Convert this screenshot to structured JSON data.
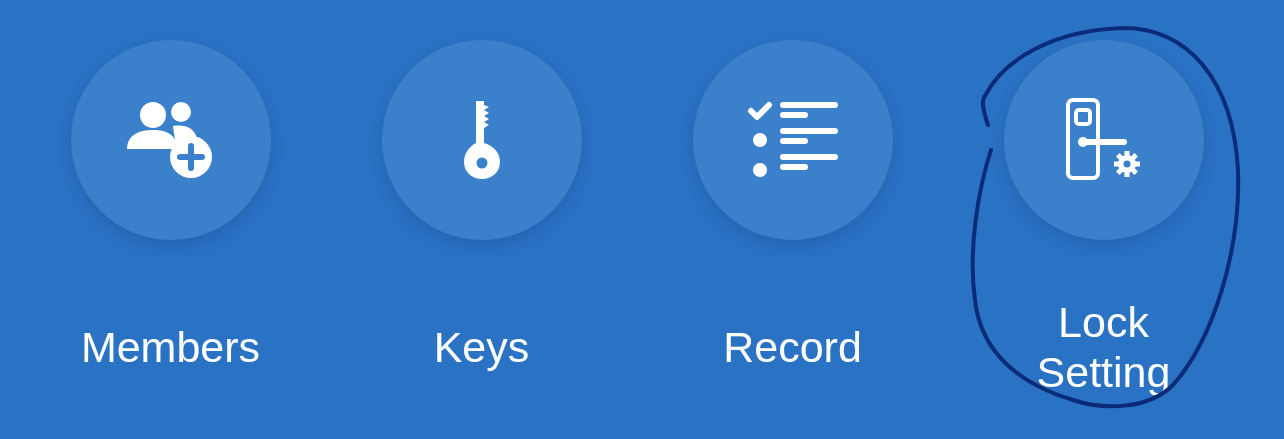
{
  "actions": [
    {
      "label": "Members",
      "highlighted": false
    },
    {
      "label": "Keys",
      "highlighted": false
    },
    {
      "label": "Record",
      "highlighted": false
    },
    {
      "label": "Lock\nSetting",
      "highlighted": true
    }
  ]
}
